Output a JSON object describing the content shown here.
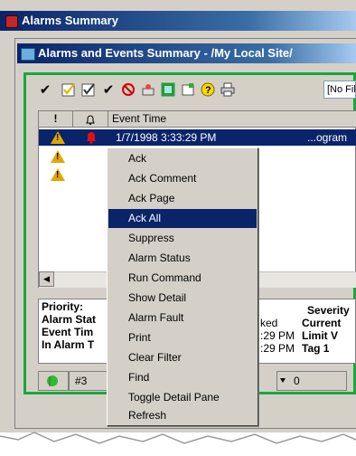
{
  "outer_window": {
    "title": "Alarms Summary"
  },
  "inner_window": {
    "title": "Alarms and Events Summary - /My Local Site/"
  },
  "toolbar": {
    "filter_value": "[No Filter]",
    "buttons": [
      "ack-icon",
      "ack-comment-icon",
      "ack-page-icon",
      "ack-all-icon",
      "suppress-icon",
      "alarm-status-icon",
      "run-command-icon",
      "show-detail-icon",
      "help-icon",
      "print-icon"
    ]
  },
  "list": {
    "headers": [
      "!",
      "🔔",
      "Event Time"
    ],
    "rows": [
      {
        "event_time": "1/7/1998 3:33:29 PM",
        "tail": "...ogram",
        "selected": true
      }
    ]
  },
  "detail": {
    "left_labels": [
      "Priority:",
      "Alarm Stat",
      "Event Tim",
      "In Alarm T"
    ],
    "mid_values": [
      "ked",
      ":29 PM",
      ":29 PM"
    ],
    "right_labels": [
      "Severity",
      "Current",
      "Limit V",
      "Tag 1"
    ]
  },
  "status": {
    "count": "#3",
    "ack_count": "0"
  },
  "context_menu": {
    "items": [
      "Ack",
      "Ack Comment",
      "Ack Page",
      "Ack All",
      "Suppress",
      "Alarm Status",
      "Run Command",
      "Show Detail",
      "Alarm Fault",
      "Print",
      "Clear Filter",
      "Find",
      "Toggle Detail Pane",
      "Refresh"
    ],
    "selected": "Ack All"
  },
  "colors": {
    "titlebar": "#0a246a",
    "frame_green": "#17a83a",
    "selection": "#0a246a",
    "warning": "#e0a800"
  }
}
